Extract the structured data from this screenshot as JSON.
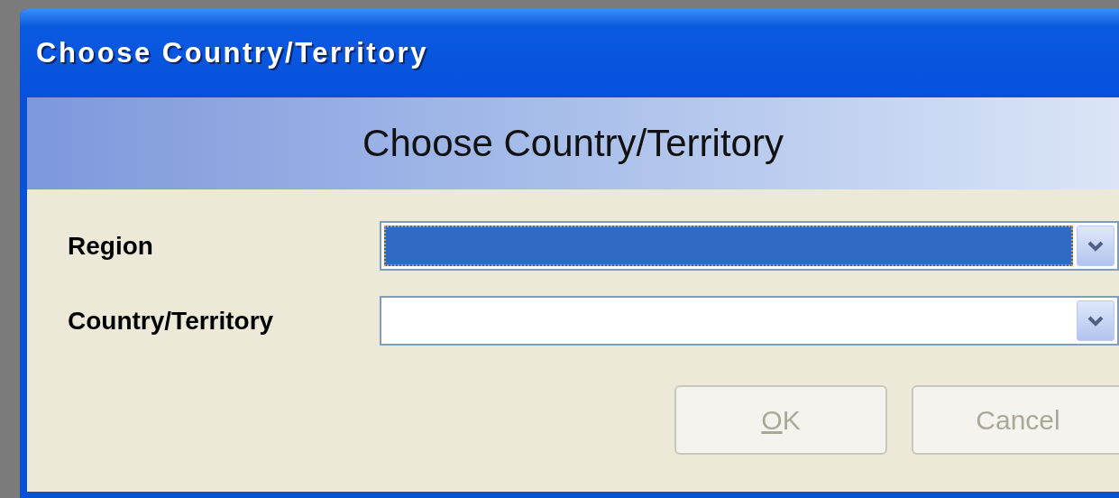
{
  "window": {
    "title": "Choose Country/Territory"
  },
  "header": {
    "title": "Choose Country/Territory"
  },
  "fields": [
    {
      "label": "Region",
      "focused": true
    },
    {
      "label": "Country/Territory",
      "focused": false
    }
  ],
  "buttons": [
    {
      "label": "OK",
      "disabled": true,
      "access_key_underlined": true
    },
    {
      "label": "Cancel",
      "disabled": true,
      "access_key_underlined": false
    }
  ]
}
